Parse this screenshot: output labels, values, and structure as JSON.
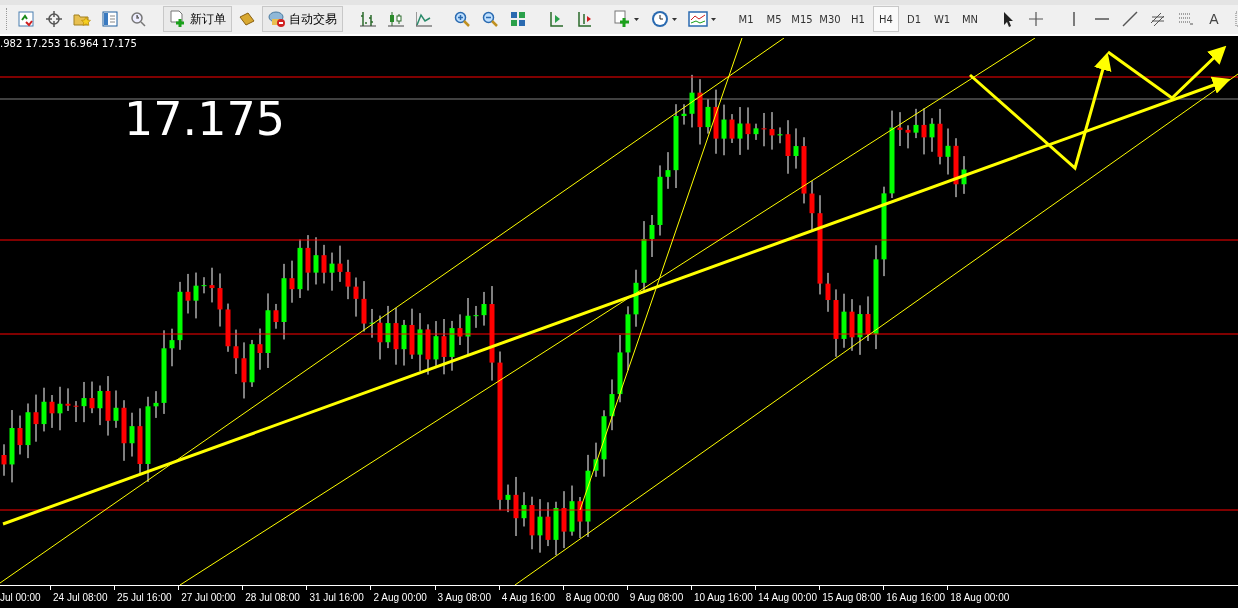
{
  "toolbar": {
    "new_order": "新订单",
    "auto_trading": "自动交易",
    "timeframes": [
      {
        "label": "M1",
        "selected": false
      },
      {
        "label": "M5",
        "selected": false
      },
      {
        "label": "M15",
        "selected": false
      },
      {
        "label": "M30",
        "selected": false
      },
      {
        "label": "H1",
        "selected": false
      },
      {
        "label": "H4",
        "selected": true
      },
      {
        "label": "D1",
        "selected": false
      },
      {
        "label": "W1",
        "selected": false
      },
      {
        "label": "MN",
        "selected": false
      }
    ],
    "text_tool": "A"
  },
  "chart": {
    "ohlc": ".982 17.253 16.964 17.175",
    "price_label": "17.175",
    "time_axis": [
      "Jul 00:00",
      "24 Jul 08:00",
      "25 Jul 16:00",
      "27 Jul 00:00",
      "28 Jul 08:00",
      "31 Jul 16:00",
      "2 Aug 00:00",
      "3 Aug 08:00",
      "4 Aug 16:00",
      "8 Aug 00:00",
      "9 Aug 08:00",
      "10 Aug 16:00",
      "14 Aug 00:00",
      "15 Aug 08:00",
      "16 Aug 16:00",
      "18 Aug 00:00"
    ]
  }
}
